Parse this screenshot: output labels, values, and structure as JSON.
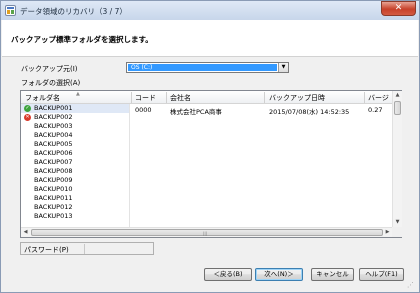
{
  "window": {
    "title": "データ領域のリカバリ（3 / 7）",
    "close_symbol": "✕",
    "icon": "app-window-icon"
  },
  "banner": {
    "heading": "バックアップ標準フォルダを選択します。"
  },
  "backup_source": {
    "label": "バックアップ元(I)",
    "value": "OS (C:)"
  },
  "folder_select_label": "フォルダの選択(A)",
  "grid": {
    "columns": [
      "フォルダ名",
      "コード",
      "会社名",
      "バックアップ日時",
      "バージ"
    ],
    "folders": [
      {
        "name": "BACKUP001",
        "status": "ok",
        "status_glyph": "✓"
      },
      {
        "name": "BACKUP002",
        "status": "error",
        "status_glyph": "✕"
      },
      {
        "name": "BACKUP003"
      },
      {
        "name": "BACKUP004"
      },
      {
        "name": "BACKUP005"
      },
      {
        "name": "BACKUP006"
      },
      {
        "name": "BACKUP007"
      },
      {
        "name": "BACKUP008"
      },
      {
        "name": "BACKUP009"
      },
      {
        "name": "BACKUP010"
      },
      {
        "name": "BACKUP011"
      },
      {
        "name": "BACKUP012"
      },
      {
        "name": "BACKUP013"
      }
    ],
    "detail_row": {
      "code": "0000",
      "company": "株式会社PCA商事",
      "datetime": "2015/07/08(水) 14:52:35",
      "version": "0.27"
    }
  },
  "password": {
    "label": "パスワード(P)",
    "value": ""
  },
  "buttons": {
    "back": "＜戻る(B)",
    "next": "次へ(N)＞",
    "cancel": "キャンセル",
    "help": "ヘルプ(F1)"
  }
}
